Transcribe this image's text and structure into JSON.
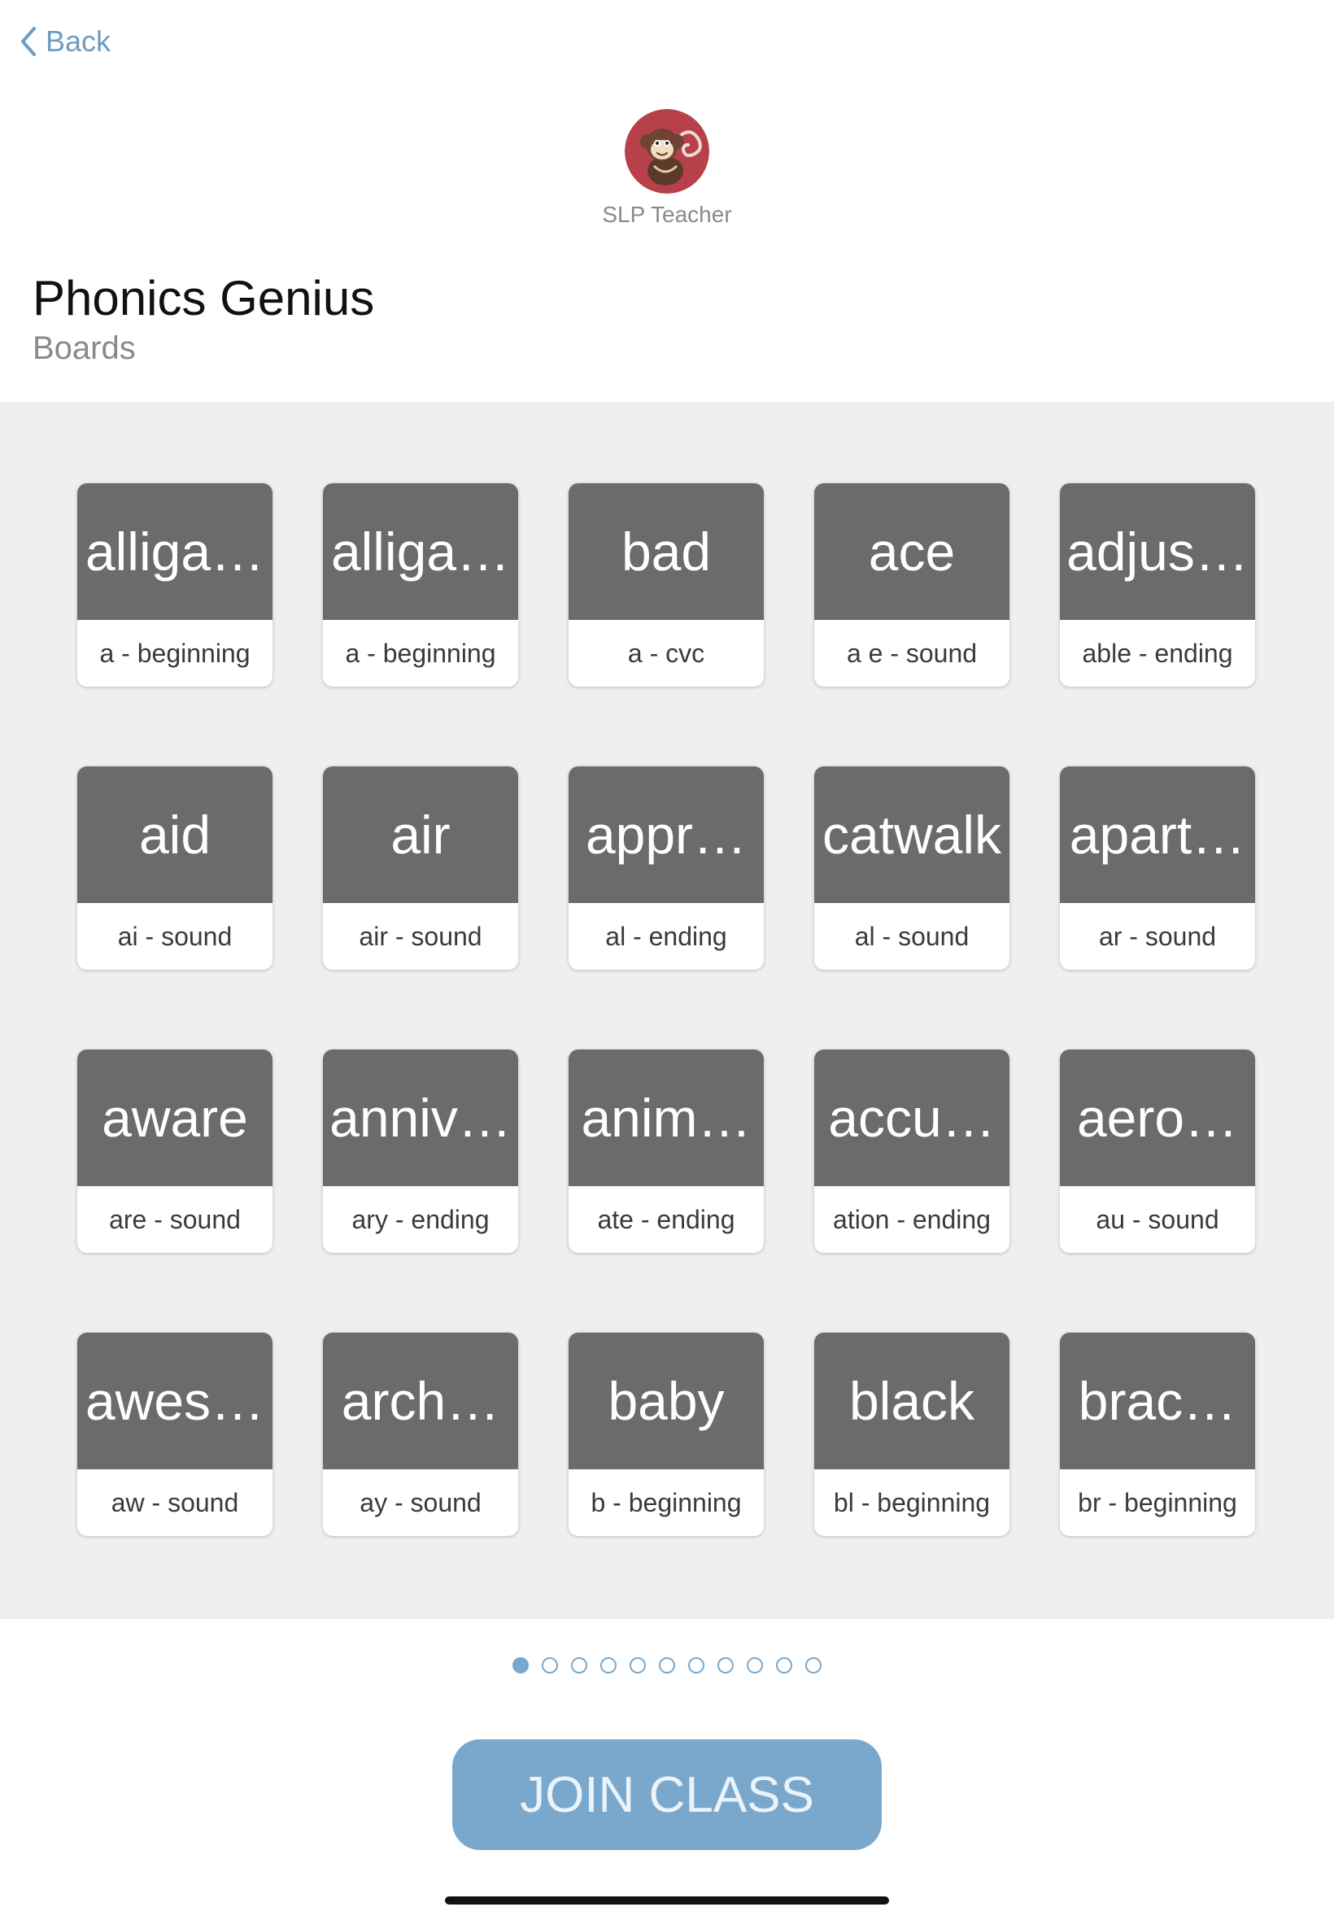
{
  "nav": {
    "back_label": "Back"
  },
  "header": {
    "owner_name": "SLP Teacher",
    "avatar_icon": "monkey-avatar-icon",
    "title": "Phonics Genius",
    "subtitle": "Boards"
  },
  "boards": [
    {
      "word": "alliga…",
      "label": "a - beginning"
    },
    {
      "word": "alliga…",
      "label": "a - beginning"
    },
    {
      "word": "bad",
      "label": "a - cvc"
    },
    {
      "word": "ace",
      "label": "a e - sound"
    },
    {
      "word": "adjus…",
      "label": "able - ending"
    },
    {
      "word": "aid",
      "label": "ai - sound"
    },
    {
      "word": "air",
      "label": "air - sound"
    },
    {
      "word": "appr…",
      "label": "al - ending"
    },
    {
      "word": "catwalk",
      "label": "al - sound"
    },
    {
      "word": "apart…",
      "label": "ar - sound"
    },
    {
      "word": "aware",
      "label": "are - sound"
    },
    {
      "word": "anniv…",
      "label": "ary - ending"
    },
    {
      "word": "anim…",
      "label": "ate - ending"
    },
    {
      "word": "accu…",
      "label": "ation - ending"
    },
    {
      "word": "aero…",
      "label": "au - sound"
    },
    {
      "word": "awes…",
      "label": "aw - sound"
    },
    {
      "word": "arch…",
      "label": "ay - sound"
    },
    {
      "word": "baby",
      "label": "b - beginning"
    },
    {
      "word": "black",
      "label": "bl - beginning"
    },
    {
      "word": "brac…",
      "label": "br - beginning"
    }
  ],
  "pagination": {
    "page_count": 11,
    "current_page": 1
  },
  "actions": {
    "join_label": "JOIN CLASS"
  },
  "colors": {
    "accent": "#7aa8cc",
    "card_header": "#6b6b6b",
    "grid_background": "#efefef"
  }
}
